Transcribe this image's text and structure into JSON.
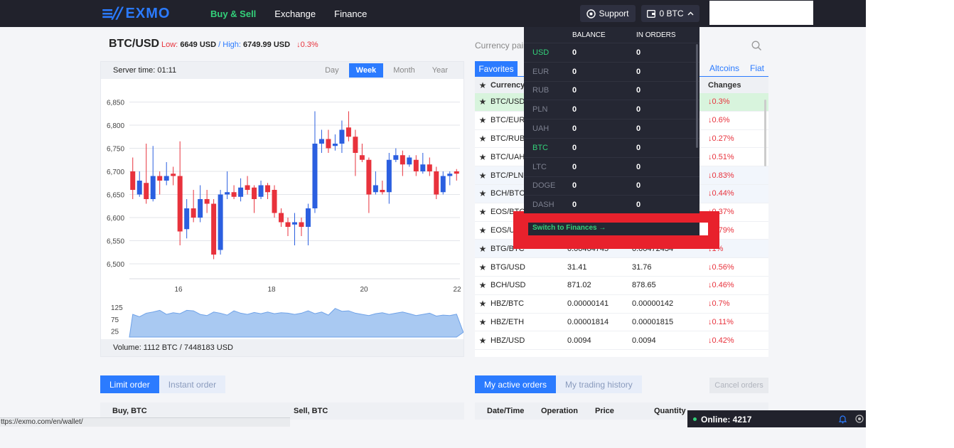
{
  "header": {
    "logo_text": "EXMO",
    "nav": [
      "Buy & Sell",
      "Exchange",
      "Finance"
    ],
    "active_nav": "Buy & Sell",
    "support_label": "Support",
    "wallet_label": "0 BTC"
  },
  "pair": {
    "name": "BTC/USD",
    "low_label": "Low:",
    "low_value": "6649 USD",
    "high_label": "High:",
    "high_value": "6749.99 USD",
    "change": "↓0.3%"
  },
  "chart_panel": {
    "server_time": "Server time: 01:11",
    "periods": [
      "Day",
      "Week",
      "Month",
      "Year"
    ],
    "active_period": "Week",
    "volume_text": "Volume: 1112 BTC / 7448183 USD"
  },
  "chart_data": {
    "type": "candlestick",
    "y_ticks": [
      "6,850",
      "6,800",
      "6,750",
      "6,700",
      "6,650",
      "6,600",
      "6,550",
      "6,500"
    ],
    "ylim": [
      6480,
      6880
    ],
    "x_ticks": [
      "16",
      "18",
      "20",
      "22"
    ],
    "volume_ticks": [
      "125",
      "75",
      "25"
    ],
    "candles": [
      {
        "o": 6700,
        "c": 6660,
        "h": 6730,
        "l": 6640,
        "up": false
      },
      {
        "o": 6650,
        "c": 6680,
        "h": 6700,
        "l": 6645,
        "up": true
      },
      {
        "o": 6675,
        "c": 6640,
        "h": 6760,
        "l": 6630,
        "up": false
      },
      {
        "o": 6640,
        "c": 6690,
        "h": 6755,
        "l": 6635,
        "up": true
      },
      {
        "o": 6690,
        "c": 6680,
        "h": 6700,
        "l": 6650,
        "up": false
      },
      {
        "o": 6680,
        "c": 6690,
        "h": 6720,
        "l": 6670,
        "up": true
      },
      {
        "o": 6695,
        "c": 6690,
        "h": 6710,
        "l": 6670,
        "up": false
      },
      {
        "o": 6690,
        "c": 6570,
        "h": 6765,
        "l": 6540,
        "up": false
      },
      {
        "o": 6575,
        "c": 6620,
        "h": 6640,
        "l": 6555,
        "up": true
      },
      {
        "o": 6620,
        "c": 6600,
        "h": 6660,
        "l": 6590,
        "up": false
      },
      {
        "o": 6600,
        "c": 6640,
        "h": 6670,
        "l": 6590,
        "up": true
      },
      {
        "o": 6640,
        "c": 6630,
        "h": 6660,
        "l": 6610,
        "up": false
      },
      {
        "o": 6630,
        "c": 6520,
        "h": 6640,
        "l": 6510,
        "up": false
      },
      {
        "o": 6530,
        "c": 6650,
        "h": 6660,
        "l": 6520,
        "up": true
      },
      {
        "o": 6650,
        "c": 6655,
        "h": 6700,
        "l": 6640,
        "up": true
      },
      {
        "o": 6655,
        "c": 6645,
        "h": 6670,
        "l": 6640,
        "up": false
      },
      {
        "o": 6645,
        "c": 6665,
        "h": 6685,
        "l": 6635,
        "up": true
      },
      {
        "o": 6670,
        "c": 6660,
        "h": 6690,
        "l": 6650,
        "up": false
      },
      {
        "o": 6665,
        "c": 6640,
        "h": 6670,
        "l": 6610,
        "up": false
      },
      {
        "o": 6645,
        "c": 6670,
        "h": 6680,
        "l": 6640,
        "up": true
      },
      {
        "o": 6670,
        "c": 6655,
        "h": 6675,
        "l": 6640,
        "up": false
      },
      {
        "o": 6660,
        "c": 6610,
        "h": 6670,
        "l": 6600,
        "up": false
      },
      {
        "o": 6610,
        "c": 6590,
        "h": 6620,
        "l": 6580,
        "up": false
      },
      {
        "o": 6590,
        "c": 6580,
        "h": 6600,
        "l": 6560,
        "up": false
      },
      {
        "o": 6585,
        "c": 6590,
        "h": 6610,
        "l": 6540,
        "up": true
      },
      {
        "o": 6590,
        "c": 6580,
        "h": 6600,
        "l": 6560,
        "up": false
      },
      {
        "o": 6580,
        "c": 6620,
        "h": 6630,
        "l": 6540,
        "up": true
      },
      {
        "o": 6620,
        "c": 6760,
        "h": 6830,
        "l": 6610,
        "up": true
      },
      {
        "o": 6760,
        "c": 6770,
        "h": 6790,
        "l": 6740,
        "up": true
      },
      {
        "o": 6770,
        "c": 6750,
        "h": 6790,
        "l": 6740,
        "up": false
      },
      {
        "o": 6755,
        "c": 6760,
        "h": 6780,
        "l": 6745,
        "up": true
      },
      {
        "o": 6760,
        "c": 6790,
        "h": 6810,
        "l": 6740,
        "up": true
      },
      {
        "o": 6795,
        "c": 6775,
        "h": 6830,
        "l": 6765,
        "up": false
      },
      {
        "o": 6775,
        "c": 6740,
        "h": 6790,
        "l": 6690,
        "up": false
      },
      {
        "o": 6735,
        "c": 6725,
        "h": 6760,
        "l": 6720,
        "up": false
      },
      {
        "o": 6725,
        "c": 6650,
        "h": 6730,
        "l": 6610,
        "up": false
      },
      {
        "o": 6655,
        "c": 6670,
        "h": 6700,
        "l": 6650,
        "up": true
      },
      {
        "o": 6660,
        "c": 6655,
        "h": 6680,
        "l": 6650,
        "up": false
      },
      {
        "o": 6655,
        "c": 6725,
        "h": 6740,
        "l": 6630,
        "up": true
      },
      {
        "o": 6725,
        "c": 6735,
        "h": 6750,
        "l": 6720,
        "up": true
      },
      {
        "o": 6735,
        "c": 6715,
        "h": 6745,
        "l": 6690,
        "up": false
      },
      {
        "o": 6715,
        "c": 6730,
        "h": 6735,
        "l": 6710,
        "up": true
      },
      {
        "o": 6725,
        "c": 6700,
        "h": 6735,
        "l": 6690,
        "up": false
      },
      {
        "o": 6700,
        "c": 6715,
        "h": 6740,
        "l": 6695,
        "up": true
      },
      {
        "o": 6715,
        "c": 6700,
        "h": 6730,
        "l": 6690,
        "up": false
      },
      {
        "o": 6700,
        "c": 6650,
        "h": 6710,
        "l": 6640,
        "up": false
      },
      {
        "o": 6655,
        "c": 6690,
        "h": 6700,
        "l": 6650,
        "up": true
      },
      {
        "o": 6690,
        "c": 6695,
        "h": 6700,
        "l": 6670,
        "up": true
      },
      {
        "o": 6700,
        "c": 6695,
        "h": 6705,
        "l": 6680,
        "up": false
      }
    ],
    "volume": [
      95,
      85,
      100,
      105,
      112,
      95,
      102,
      98,
      112,
      110,
      95,
      90,
      105,
      100,
      92,
      110,
      100,
      95,
      103,
      98,
      105,
      98,
      102,
      100,
      95,
      100,
      110,
      98,
      105,
      92,
      120,
      108,
      110,
      100,
      95,
      90,
      98,
      102,
      95,
      100,
      105,
      98,
      90,
      95,
      100,
      88,
      92,
      90,
      96,
      20
    ]
  },
  "market": {
    "label": "Currency pair",
    "tabs": [
      "Favorites",
      "Altcoins",
      "Fiat"
    ],
    "active_tab": "Favorites",
    "headers": [
      "Currency P",
      "Changes"
    ],
    "rows": [
      {
        "pair": "BTC/USD",
        "buy": "",
        "sell": "",
        "change": "↓0.3%"
      },
      {
        "pair": "BTC/EUR",
        "buy": "",
        "sell": "",
        "change": "↓0.6%"
      },
      {
        "pair": "BTC/RUB",
        "buy": "",
        "sell": "",
        "change": "↓0.27%"
      },
      {
        "pair": "BTC/UAH",
        "buy": "",
        "sell": "",
        "change": "↓0.51%"
      },
      {
        "pair": "BTC/PLN",
        "buy": "",
        "sell": "",
        "change": "↓0.83%"
      },
      {
        "pair": "BCH/BTC",
        "buy": "",
        "sell": "",
        "change": "↓0.44%"
      },
      {
        "pair": "EOS/BTC",
        "buy": "",
        "sell": "",
        "change": "↓0.37%"
      },
      {
        "pair": "EOS/USD",
        "buy": "",
        "sell": "",
        "change": "↓0.79%"
      },
      {
        "pair": "BTG/BTC",
        "buy": "0.00464745",
        "sell": "0.00472434",
        "change": "↓1%"
      },
      {
        "pair": "BTG/USD",
        "buy": "31.41",
        "sell": "31.76",
        "change": "↓0.56%"
      },
      {
        "pair": "BCH/USD",
        "buy": "871.02",
        "sell": "878.65",
        "change": "↓0.46%"
      },
      {
        "pair": "HBZ/BTC",
        "buy": "0.00000141",
        "sell": "0.00000142",
        "change": "↓0.7%"
      },
      {
        "pair": "HBZ/ETH",
        "buy": "0.00001814",
        "sell": "0.00001815",
        "change": "↓0.11%"
      },
      {
        "pair": "HBZ/USD",
        "buy": "0.0094",
        "sell": "0.0094",
        "change": "↓0.42%"
      }
    ]
  },
  "balance_dropdown": {
    "headers": [
      "BALANCE",
      "IN ORDERS"
    ],
    "rows": [
      {
        "currency": "USD",
        "balance": "0",
        "in_orders": "0",
        "highlight": true
      },
      {
        "currency": "EUR",
        "balance": "0",
        "in_orders": "0",
        "highlight": false
      },
      {
        "currency": "RUB",
        "balance": "0",
        "in_orders": "0",
        "highlight": false
      },
      {
        "currency": "PLN",
        "balance": "0",
        "in_orders": "0",
        "highlight": false
      },
      {
        "currency": "UAH",
        "balance": "0",
        "in_orders": "0",
        "highlight": false
      },
      {
        "currency": "BTC",
        "balance": "0",
        "in_orders": "0",
        "highlight": true
      },
      {
        "currency": "LTC",
        "balance": "0",
        "in_orders": "0",
        "highlight": false
      },
      {
        "currency": "DOGE",
        "balance": "0",
        "in_orders": "0",
        "highlight": false
      },
      {
        "currency": "DASH",
        "balance": "0",
        "in_orders": "0",
        "highlight": false
      }
    ],
    "switch_label": "Switch to Finances →"
  },
  "orders": {
    "tabs": [
      "Limit order",
      "Instant order"
    ],
    "buy_label": "Buy, BTC",
    "sell_label": "Sell, BTC",
    "my_tabs": [
      "My active orders",
      "My trading history"
    ],
    "cancel_label": "Cancel orders",
    "columns": [
      "Date/Time",
      "Operation",
      "Price",
      "Quantity"
    ]
  },
  "footer": {
    "online_text": "Online: 4217",
    "status_url": "ttps://exmo.com/en/wallet/"
  },
  "colors": {
    "accent": "#2b7bff",
    "green": "#33d17a",
    "red": "#e8323c",
    "topbar": "#21222c",
    "highlight_box": "#e8212c"
  }
}
